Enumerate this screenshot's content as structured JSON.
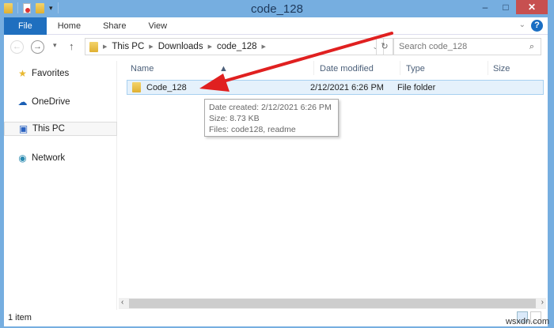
{
  "window": {
    "title": "code_128",
    "minimize": "–",
    "maximize": "□",
    "close": "✕"
  },
  "ribbon": {
    "tabs": [
      "File",
      "Home",
      "Share",
      "View"
    ],
    "help": "?",
    "expand": "⌄"
  },
  "nav": {
    "back": "←",
    "forward": "→",
    "recent": "▾",
    "up": "↑",
    "breadcrumb": [
      "This PC",
      "Downloads",
      "code_128"
    ],
    "refresh": "↻",
    "search_placeholder": "Search code_128",
    "search_icon": "⌕"
  },
  "sidebar": {
    "items": [
      {
        "label": "Favorites",
        "icon": "★"
      },
      {
        "label": "OneDrive",
        "icon": "☁"
      },
      {
        "label": "This PC",
        "icon": "▣"
      },
      {
        "label": "Network",
        "icon": "◉"
      }
    ]
  },
  "columns": [
    "Name",
    "Date modified",
    "Type",
    "Size"
  ],
  "files": [
    {
      "name": "Code_128",
      "date": "2/12/2021 6:26 PM",
      "type": "File folder",
      "size": ""
    }
  ],
  "tooltip": {
    "line1": "Date created: 2/12/2021 6:26 PM",
    "line2": "Size: 8.73 KB",
    "line3": "Files: code128, readme"
  },
  "status": {
    "count": "1 item"
  },
  "watermark": "wsxdn.com",
  "colors": {
    "frame": "#76aee0",
    "accent": "#1f6fbf",
    "selection": "#e5f1fb",
    "arrow": "#e02020"
  }
}
